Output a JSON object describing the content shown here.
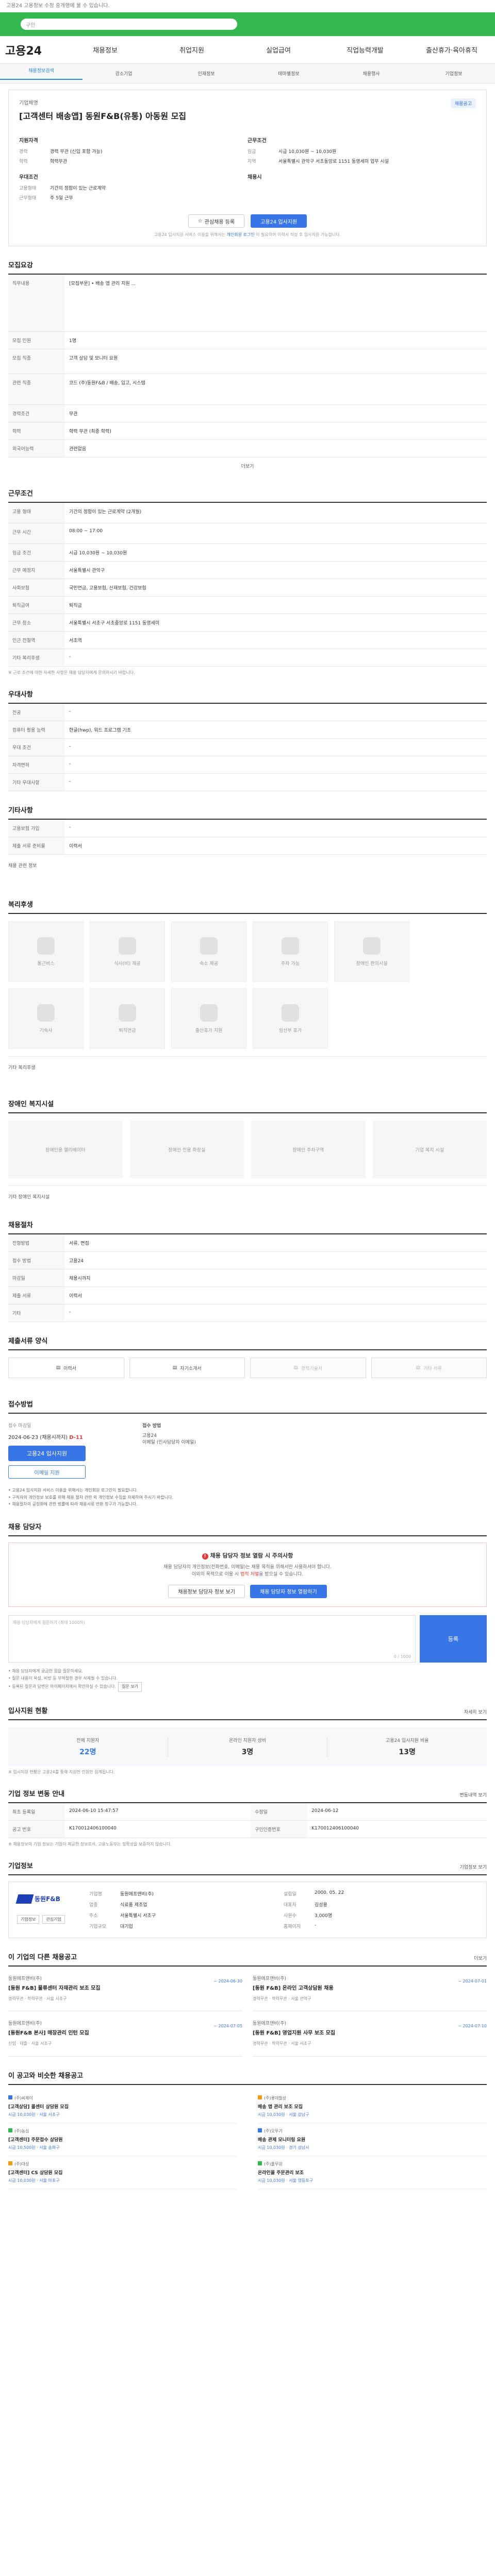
{
  "top_note": "고용24 고용정보 수정 중개행에 불 수 있습니다.",
  "search_placeholder": "구인",
  "nav": {
    "logo": "고용24",
    "items": [
      "채용정보",
      "취업지원",
      "실업급여",
      "직업능력개발",
      "출산휴가·육아휴직"
    ]
  },
  "subnav": [
    "채용정보검색",
    "강소기업",
    "인재정보",
    "테마별정보",
    "채용행사",
    "기업정보"
  ],
  "job": {
    "company": "기업체명",
    "title": "[고객센터 배송앱] 동원F&B(유통) 아동원 모집",
    "badge": "채용공고",
    "info_left_head": "지원자격",
    "info_left": [
      {
        "k": "경력",
        "v": "경력 무관 (신입 포함 가능)"
      },
      {
        "k": "학력",
        "v": "학력무관"
      }
    ],
    "info_left_head2": "우대조건",
    "info_left2": [
      {
        "k": "고용형태",
        "v": "기간의 정함이 있는 근로계약"
      },
      {
        "k": "근무형태",
        "v": "주 5일 근무"
      }
    ],
    "info_right_head": "근무조건",
    "info_right": [
      {
        "k": "임금",
        "v": "시급 10,030원 ~ 10,030원"
      },
      {
        "k": "지역",
        "v": "서울특별시 관악구 서초동앙로 1151 동영세미 업무 시설"
      }
    ],
    "info_right_head2": "채용시",
    "scrap_label": "관심채용 등록",
    "apply_label": "고용24 입사지원",
    "apply_note": "고용24 입사지원 서비스 이용을 위해서는",
    "apply_note_link": "개인회원 로그인",
    "apply_note_tail": "이 필요하여 이력서 작성 후 입사지원 가능합니다."
  },
  "recruit": {
    "title": "모집요강",
    "rows": [
      {
        "k": "직무내용",
        "v": "[모집부문] • 배송 앱 관리 지원 ..."
      },
      {
        "k": "모집 인원",
        "v": "1명"
      },
      {
        "k": "모집 직종",
        "v": "고객 상담 및 모니터 요원"
      },
      {
        "k": "관련 직종",
        "v": "코드 (주)동원F&B / 배송, 입고, 시스템"
      },
      {
        "k": "경력조건",
        "v": "무관"
      },
      {
        "k": "학력",
        "v": "학력 무관 (최종 학력)"
      },
      {
        "k": "외국어능력",
        "v": "관련없음"
      }
    ],
    "more_label": "더보기"
  },
  "work": {
    "title": "근무조건",
    "rows": [
      {
        "k": "고용 형태",
        "v": "기간의 정함이 있는 근로계약 (2개월)"
      },
      {
        "k": "근무 시간",
        "v": "08:00 ~ 17:00"
      },
      {
        "k": "임금 조건",
        "v": "시급 10,030원 ~ 10,030원"
      },
      {
        "k": "근무 예정지",
        "v": "서울특별시 관악구"
      },
      {
        "k": "사회보험",
        "v": "국민연금, 고용보험, 산재보험, 건강보험"
      },
      {
        "k": "퇴직급여",
        "v": "퇴직금"
      },
      {
        "k": "근무 장소",
        "v": "서울특별시 서초구 서초중앙로 1151 동영세미"
      },
      {
        "k": "인근 전철역",
        "v": "서초역"
      },
      {
        "k": "기타 복리후생",
        "v": "-"
      }
    ],
    "note": "※ 근로 조건에 대한 자세한 사항은 채용 담당자에게 문의하시기 바랍니다."
  },
  "etc": {
    "title": "우대사항",
    "rows": [
      {
        "k": "전공",
        "v": "-"
      },
      {
        "k": "컴퓨터 활용 능력",
        "v": "한글(hwp), 워드 프로그램 기초"
      },
      {
        "k": "우대 조건",
        "v": "-"
      },
      {
        "k": "자격면허",
        "v": "-"
      },
      {
        "k": "기타 우대사항",
        "v": "-"
      }
    ]
  },
  "other": {
    "title": "기타사항",
    "rows": [
      {
        "k": "고용보험 가입",
        "v": "-"
      },
      {
        "k": "제출 서류 준비물",
        "v": "이력서"
      }
    ],
    "more_label": "채용 관련 정보"
  },
  "welfare": {
    "title": "복리후생",
    "items": [
      "통근버스",
      "식사(비) 제공",
      "숙소 제공",
      "주차 가능",
      "장애인 편의시설",
      "기숙사",
      "퇴직연금",
      "출산휴가 지원",
      "임산부 휴가"
    ],
    "note": "기타 복리후생"
  },
  "welfare2": {
    "title": "장애인 복지시설",
    "items": [
      "장애인용 엘리베이터",
      "장애인 전용 화장실",
      "장애인 주차구역",
      "기업 복지 시설"
    ],
    "note": "기타 장애인 복지시설"
  },
  "selection": {
    "title": "채용절차",
    "rows": [
      {
        "k": "전형방법",
        "v": "서류, 면접"
      },
      {
        "k": "접수 방법",
        "v": "고용24"
      },
      {
        "k": "마감일",
        "v": "채용시까지"
      },
      {
        "k": "제출 서류",
        "v": "이력서"
      },
      {
        "k": "기타",
        "v": "-"
      }
    ]
  },
  "docs": {
    "title": "제출서류 양식",
    "items": [
      "이력서",
      "자기소개서",
      "경력기술서",
      "기타 서류"
    ]
  },
  "apply": {
    "title": "접수방법",
    "deadline_label": "접수 마감일",
    "deadline": "2024-06-23 (채용시까지)",
    "deadline_red": "D-11",
    "apply_btn": "고용24 입사지원",
    "other_btn": "이메일 지원",
    "right_head": "접수 방법",
    "right_items": [
      "고용24",
      "이메일 (인사담당자 이메일)"
    ],
    "notes": [
      "• 고용24 입사지원 서비스 이용을 위해서는 개인회원 로그인이 필요합니다.",
      "• 구직자의 개인정보 보호를 위해 채용 절차 관련 외 개인정보 수집을 자제하여 주시기 바랍니다.",
      "• 채용절차의 공정화에 관한 법률에 따라 채용서류 반환 청구가 가능합니다."
    ]
  },
  "contact": {
    "title": "채용 담당자",
    "warning_title": "채용 담당자 정보 열람 시 주의사항",
    "warning_text1": "채용 담당자의 개인정보(전화번호, 이메일)는 채용 목적을 위해서만 사용하셔야 합니다.",
    "warning_text2": "이외의 목적으로 이용 시",
    "warning_red": "법적 처벌",
    "warning_text3": "을 받으실 수 있습니다.",
    "btn1": "채용정보 담당자 정보 보기",
    "btn2": "채용 담당자 정보 열람하기",
    "qa_placeholder": "채용 담당자에게 질문하기 (최대 1000자)",
    "qa_counter": "0 / 1000",
    "qa_btn": "등록",
    "qa_notes": [
      "• 채용 담당자에게 궁금한 점을 질문하세요.",
      "• 질문 내용이 욕설, 비방 등 부적절한 경우 삭제될 수 있습니다.",
      "• 등록된 질문과 답변은 마이페이지에서 확인하실 수 있습니다."
    ],
    "qa_link": "질문 보기"
  },
  "status": {
    "title": "입사지원 현황",
    "more": "자세히 보기",
    "items": [
      {
        "label": "전체 지원자",
        "value": "22명"
      },
      {
        "label": "온라인 지원자 성비",
        "value": "3명"
      },
      {
        "label": "고용24 입사지원 비율",
        "value": "13명"
      }
    ],
    "note": "※ 입사지원 현황은 고용24를 통해 지원한 인원만 집계됩니다."
  },
  "info_update": {
    "title": "기업 정보 변동 안내",
    "more": "변동내역 보기",
    "rows": [
      {
        "k": "최초 등록일",
        "v": "2024-06-10 15:47:57",
        "k2": "수정일",
        "v2": "2024-06-12"
      },
      {
        "k": "공고 번호",
        "v": "K170012406100040",
        "k2": "구인인증번호",
        "v2": "K170012406100040"
      }
    ],
    "note": "※ 채용정보의 기업 정보는 기업이 제공한 정보로서, 고용노동부는 정확성을 보증하지 않습니다."
  },
  "company": {
    "title": "기업정보",
    "more": "기업정보 보기",
    "logo_text": "동원F&B",
    "btns": [
      "기업정보",
      "관심기업"
    ],
    "grid": [
      {
        "k": "기업명",
        "v": "동원에프앤비(주)",
        "k2": "설립일",
        "v2": "2000. 05. 22"
      },
      {
        "k": "업종",
        "v": "식료품 제조업",
        "k2": "대표자",
        "v2": "김성용"
      },
      {
        "k": "주소",
        "v": "서울특별시 서초구",
        "k2": "사원수",
        "v2": "3,000명"
      },
      {
        "k": "기업규모",
        "v": "대기업",
        "k2": "홈페이지",
        "v2": "-"
      }
    ]
  },
  "similar": {
    "title": "이 기업의 다른 채용공고",
    "more": "더보기",
    "items": [
      {
        "co": "동원에프앤비(주)",
        "tt": "[동원 F&B] 물류센터 자재관리 보조 모집",
        "meta": "경력무관 · 학력무관 · 서울 서초구",
        "side": "~ 2024-06-30"
      },
      {
        "co": "동원에프앤비(주)",
        "tt": "[동원 F&B] 온라인 고객상담원 채용",
        "meta": "경력무관 · 학력무관 · 서울 관악구",
        "side": "~ 2024-07-01"
      },
      {
        "co": "동원에프앤비(주)",
        "tt": "[동원F&B 본사] 매장관리 인턴 모집",
        "meta": "신입 · 대졸 · 서울 서초구",
        "side": "~ 2024-07-05"
      },
      {
        "co": "동원에프앤비(주)",
        "tt": "[동원 F&B] 영업지원 사무 보조 모집",
        "meta": "경력무관 · 학력무관 · 서울 서초구",
        "side": "~ 2024-07-10"
      }
    ]
  },
  "recommend": {
    "title": "이 공고와 비슷한 채용공고",
    "items": [
      {
        "co": "(주)씨제이",
        "tt": "[고객상담] 콜센터 상담원 모집",
        "meta": "시급 10,030원 · 서울 서초구"
      },
      {
        "co": "(주)롯데칠성",
        "tt": "배송 앱 관리 보조 모집",
        "meta": "시급 10,030원 · 서울 강남구"
      },
      {
        "co": "(주)농심",
        "tt": "[고객센터] 주문접수 상담원",
        "meta": "시급 10,500원 · 서울 송파구"
      },
      {
        "co": "(주)오뚜기",
        "tt": "배송 관제 모니터링 요원",
        "meta": "시급 10,030원 · 경기 성남시"
      },
      {
        "co": "(주)대상",
        "tt": "[고객센터] CS 상담원 모집",
        "meta": "시급 10,030원 · 서울 마포구"
      },
      {
        "co": "(주)풀무원",
        "tt": "온라인몰 주문관리 보조",
        "meta": "시급 10,030원 · 서울 영등포구"
      }
    ]
  }
}
